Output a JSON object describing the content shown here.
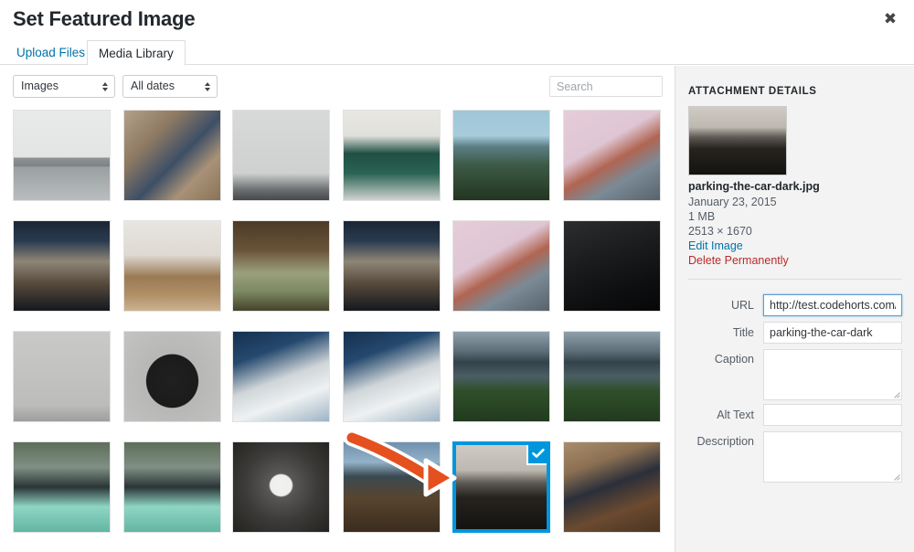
{
  "modal": {
    "title": "Set Featured Image",
    "close_icon": "close-icon",
    "close_glyph": "✖"
  },
  "tabs": [
    {
      "label": "Upload Files",
      "active": false
    },
    {
      "label": "Media Library",
      "active": true
    }
  ],
  "toolbar": {
    "filter_type": "Images",
    "filter_date": "All dates",
    "search_placeholder": "Search",
    "search_value": ""
  },
  "grid": {
    "columns": 6,
    "rows": 4,
    "items": [
      {
        "id": 1,
        "name": "bridge-pillars-bw",
        "selected": false
      },
      {
        "id": 2,
        "name": "red-mailbox-mural",
        "selected": false
      },
      {
        "id": 3,
        "name": "glass-lattice-roof",
        "selected": false
      },
      {
        "id": 4,
        "name": "green-bridge-underside",
        "selected": false
      },
      {
        "id": 5,
        "name": "coastal-city-ocean",
        "selected": false
      },
      {
        "id": 6,
        "name": "golden-gate-pink-sky",
        "selected": false
      },
      {
        "id": 7,
        "name": "narrow-old-town-street",
        "selected": false
      },
      {
        "id": 8,
        "name": "dining-table-chairs",
        "selected": false
      },
      {
        "id": 9,
        "name": "under-pier-waves",
        "selected": false
      },
      {
        "id": 10,
        "name": "narrow-old-town-street-2",
        "selected": false
      },
      {
        "id": 11,
        "name": "golden-gate-pink-sky-2",
        "selected": false
      },
      {
        "id": 12,
        "name": "scuba-diver-dark-water",
        "selected": false
      },
      {
        "id": 13,
        "name": "type-specimen-sheet",
        "selected": false
      },
      {
        "id": 14,
        "name": "black-typewriter",
        "selected": false
      },
      {
        "id": 15,
        "name": "sunlit-clouds-sky",
        "selected": false
      },
      {
        "id": 16,
        "name": "sunlit-clouds-sky-2",
        "selected": false
      },
      {
        "id": 17,
        "name": "kayak-feet-lake",
        "selected": false
      },
      {
        "id": 18,
        "name": "kayak-feet-lake-2",
        "selected": false
      },
      {
        "id": 19,
        "name": "mint-scooter-street",
        "selected": false
      },
      {
        "id": 20,
        "name": "mint-scooter-street-2",
        "selected": false
      },
      {
        "id": 21,
        "name": "white-window-dark-frame",
        "selected": false
      },
      {
        "id": 22,
        "name": "wooden-pier-sunset",
        "selected": false
      },
      {
        "id": 23,
        "name": "parking-the-car-dark",
        "selected": true
      },
      {
        "id": 24,
        "name": "person-sitting-stool",
        "selected": false
      }
    ],
    "selected_index": 22,
    "check_icon": "checkmark-icon"
  },
  "sidebar": {
    "heading": "ATTACHMENT DETAILS",
    "filename": "parking-the-car-dark.jpg",
    "date": "January 23, 2015",
    "filesize": "1 MB",
    "dimensions": "2513 × 1670",
    "edit_image_label": "Edit Image",
    "delete_label": "Delete Permanently",
    "fields": [
      {
        "label": "URL",
        "value": "http://test.codehorts.com/w",
        "type": "input",
        "focused": true
      },
      {
        "label": "Title",
        "value": "parking-the-car-dark",
        "type": "input",
        "focused": false
      },
      {
        "label": "Caption",
        "value": "",
        "type": "textarea",
        "focused": false
      },
      {
        "label": "Alt Text",
        "value": "",
        "type": "input",
        "focused": false
      },
      {
        "label": "Description",
        "value": "",
        "type": "textarea",
        "focused": false
      }
    ]
  },
  "annotation": {
    "type": "curved-arrow",
    "color": "#e4501e",
    "outline_color": "#ffffff",
    "points_to": "parking-the-car-dark"
  },
  "colors": {
    "accent_blue": "#0073aa",
    "selection_blue": "#0096dd",
    "danger_red": "#bb2a2a",
    "sidebar_bg": "#f3f3f3",
    "border": "#dddddd",
    "arrow_orange": "#e4501e"
  }
}
